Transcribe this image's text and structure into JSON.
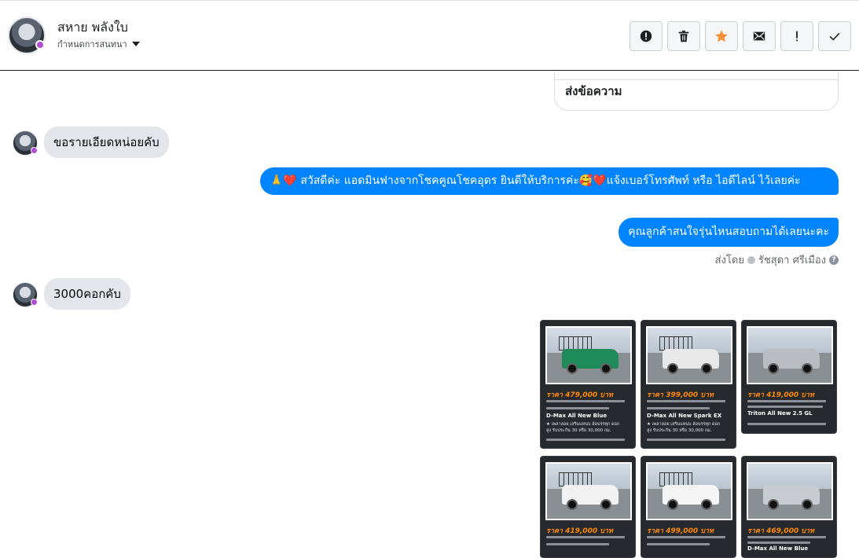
{
  "header": {
    "user_name": "สหาย พลังใบ",
    "sub_label": "กำหนดการสนทนา",
    "actions": [
      {
        "name": "report-button",
        "icon": "alert-circle-icon"
      },
      {
        "name": "delete-button",
        "icon": "trash-icon"
      },
      {
        "name": "star-button",
        "icon": "star-icon",
        "color": "#f7923a"
      },
      {
        "name": "mail-button",
        "icon": "envelope-icon"
      },
      {
        "name": "important-button",
        "icon": "exclamation-icon"
      },
      {
        "name": "done-button",
        "icon": "checkmark-icon"
      }
    ]
  },
  "chat": {
    "prev_card_action": "ส่งข้อความ",
    "messages": [
      {
        "direction": "in",
        "text": "ขอรายเอียดหน่อยคับ"
      },
      {
        "direction": "out",
        "text": "🙏❤️ สวัสดีค่ะ แอดมินฟางจากโชคคูณโชคอุดร ยินดีให้บริการค่ะ🥰❤️แจ้งเบอร์โทรศัพท์ หรือ ไอดีไลน์  ไว้เลยค่ะ"
      },
      {
        "direction": "out",
        "text": "คุณลูกค้าสนใจรุ่นไหนสอบถามได้เลยนะคะ"
      },
      {
        "direction": "in",
        "text": "3000คอกคับ"
      }
    ],
    "sent_by_label": "ส่งโดย",
    "sent_by_name": "รัชสุดา ศรีเมือง",
    "cards": [
      {
        "price": "ราคา 479,000 บาท",
        "model": "D-Max All New Blue",
        "desc1": "★ เพลาลอย เสริมแหนบ ล้อบรรทุก ดอก",
        "desc2": "สูง รับประกัน 30 หรือ 30,000 กม.",
        "car_color": "#1f8a5a"
      },
      {
        "price": "ราคา 399,000 บาท",
        "model": "D-Max All New Spark EX",
        "desc1": "★ เพลาลอย เสริมแหนบ ล้อบรรทุก ดอก",
        "desc2": "สูง รับประกัน 30 หรือ 30,000 กม.",
        "car_color": "#e8e8e8"
      },
      {
        "price": "ราคา 419,000 บาท",
        "model": "Triton All New 2.5 GL",
        "desc1": "",
        "desc2": "",
        "car_color": "#b9bcc0"
      },
      {
        "price": "ราคา 419,000 บาท",
        "model": "",
        "desc1": "",
        "desc2": "",
        "car_color": "#f2f2f2"
      },
      {
        "price": "ราคา 499,000 บาท",
        "model": "",
        "desc1": "",
        "desc2": "",
        "car_color": "#f5f5f5"
      },
      {
        "price": "ราคา 469,000 บาท",
        "model": "D-Max All New Blue",
        "desc1": "",
        "desc2": "",
        "car_color": "#c8ccd2"
      }
    ]
  }
}
